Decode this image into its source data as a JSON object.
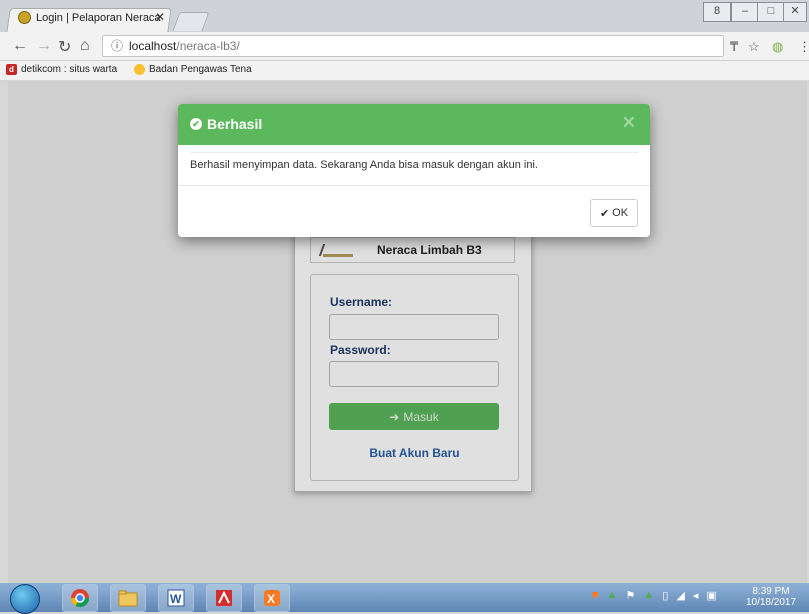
{
  "browser": {
    "tab_title": "Login | Pelaporan Neraca",
    "tab_close": "✕",
    "url_host": "localhost",
    "url_path": "/neraca-lb3/",
    "bookmarks": [
      {
        "label": "detikcom : situs warta"
      },
      {
        "label": "Badan Pengawas Tena"
      }
    ],
    "window_controls": [
      "8",
      "–",
      "□",
      "✕"
    ]
  },
  "login": {
    "brand_name": "Neraca Limbah B3",
    "username_label": "Username:",
    "password_label": "Password:",
    "submit_label": "Masuk",
    "signup_link": "Buat Akun Baru"
  },
  "modal": {
    "title": "Berhasil",
    "close_glyph": "✕",
    "message": "Berhasil menyimpan data. Sekarang Anda bisa masuk dengan akun ini.",
    "ok_label": "OK"
  },
  "taskbar": {
    "time": "8:39 PM",
    "date": "10/18/2017"
  },
  "colors": {
    "success": "#5cb85c",
    "link": "#2a5fa8",
    "label": "#1f3b6e"
  }
}
